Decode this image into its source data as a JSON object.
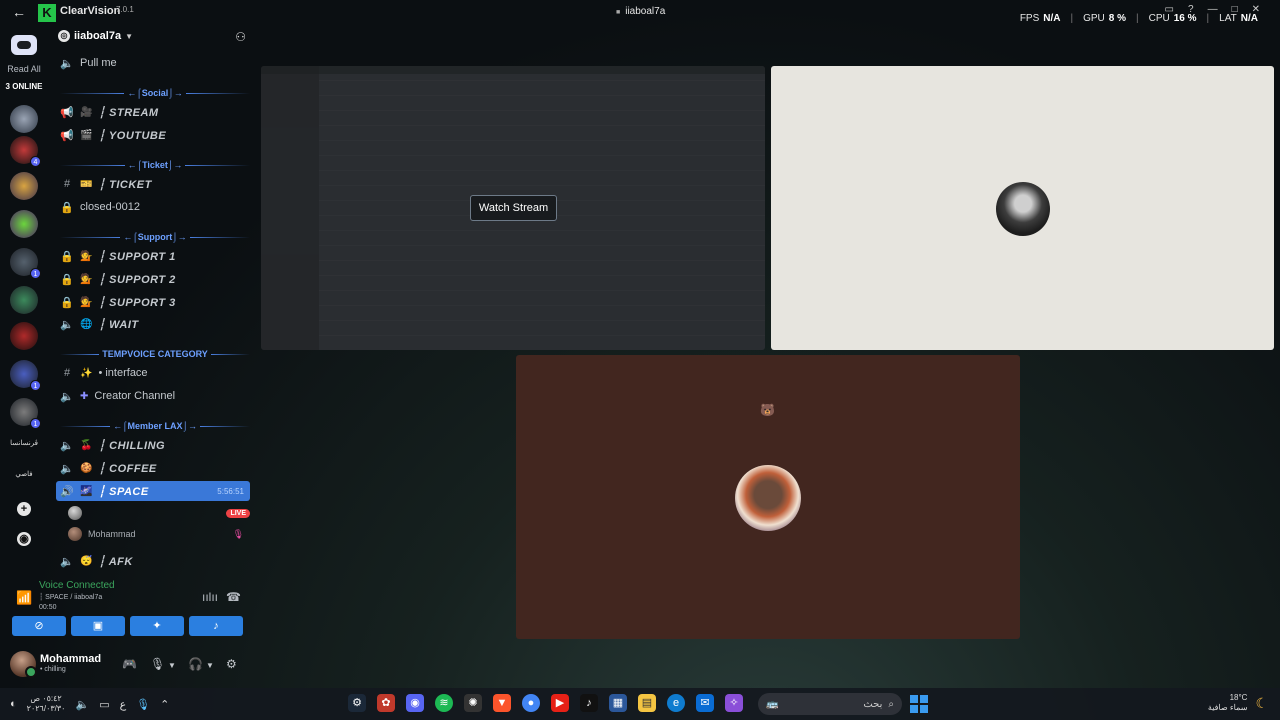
{
  "overlay": {
    "app_name": "ClearVision",
    "version": "7.0.1",
    "window_title": "iiaboal7a",
    "stats": [
      {
        "label": "FPS",
        "value": "N/A"
      },
      {
        "label": "GPU",
        "value": "8 %"
      },
      {
        "label": "CPU",
        "value": "16 %"
      },
      {
        "label": "LAT",
        "value": "N/A"
      }
    ]
  },
  "rail": {
    "read_all": "Read All",
    "online": "3 ONLINE",
    "servers": [
      {
        "badge": ""
      },
      {
        "badge": "4"
      },
      {
        "badge": ""
      },
      {
        "badge": ""
      },
      {
        "badge": "1"
      },
      {
        "badge": ""
      },
      {
        "badge": ""
      },
      {
        "badge": "1"
      },
      {
        "badge": "1"
      }
    ],
    "text_servers": [
      "ڤرنسانسا",
      "فاصي"
    ]
  },
  "guild": {
    "name": "iiaboal7a"
  },
  "channels": {
    "pull_me": "Pull me",
    "cat_social": "←⌠Social⌡→",
    "stream": "┆ STREAM",
    "youtube": "┆ YOUTUBE",
    "cat_ticket": "←⌠Ticket⌡→",
    "ticket": "┆ TICKET",
    "closed": "closed-0012",
    "cat_support": "←⌠Support⌡→",
    "support1": "┆ SUPPORT 1",
    "support2": "┆ SUPPORT 2",
    "support3": "┆ SUPPORT 3",
    "wait": "┆ WAIT",
    "cat_tempvoice": "TEMPVOICE CATEGORY",
    "interface": "• interface",
    "creator": "Creator Channel",
    "cat_member": "←⌠Member LAX⌡→",
    "chilling": "┆ CHILLING",
    "coffee": "┆ COFFEE",
    "space": "┆ SPACE",
    "space_timer": "5:56:51",
    "afk": "┆ AFK"
  },
  "voice_users": [
    {
      "name": "",
      "badge": "LIVE"
    },
    {
      "name": "Mohammad",
      "badge": ""
    }
  ],
  "voice_panel": {
    "title": "Voice Connected",
    "channel": "┆ SPACE / iiaboal7a",
    "time": "00:50"
  },
  "user": {
    "name": "Mohammad",
    "status": "• chilling"
  },
  "stage": {
    "watch_stream": "Watch Stream"
  },
  "taskbar": {
    "clock_time": "٠٥:٤٢ ص",
    "clock_date": "٢٠٢٦/٠٣/٣٠",
    "lang": "ع",
    "search_placeholder": "بحث",
    "temp": "18°C",
    "weather": "سماء صافية"
  },
  "colors": {
    "accent": "#3a78d8",
    "voice_green": "#3ba55d",
    "live_red": "#ed4245"
  }
}
